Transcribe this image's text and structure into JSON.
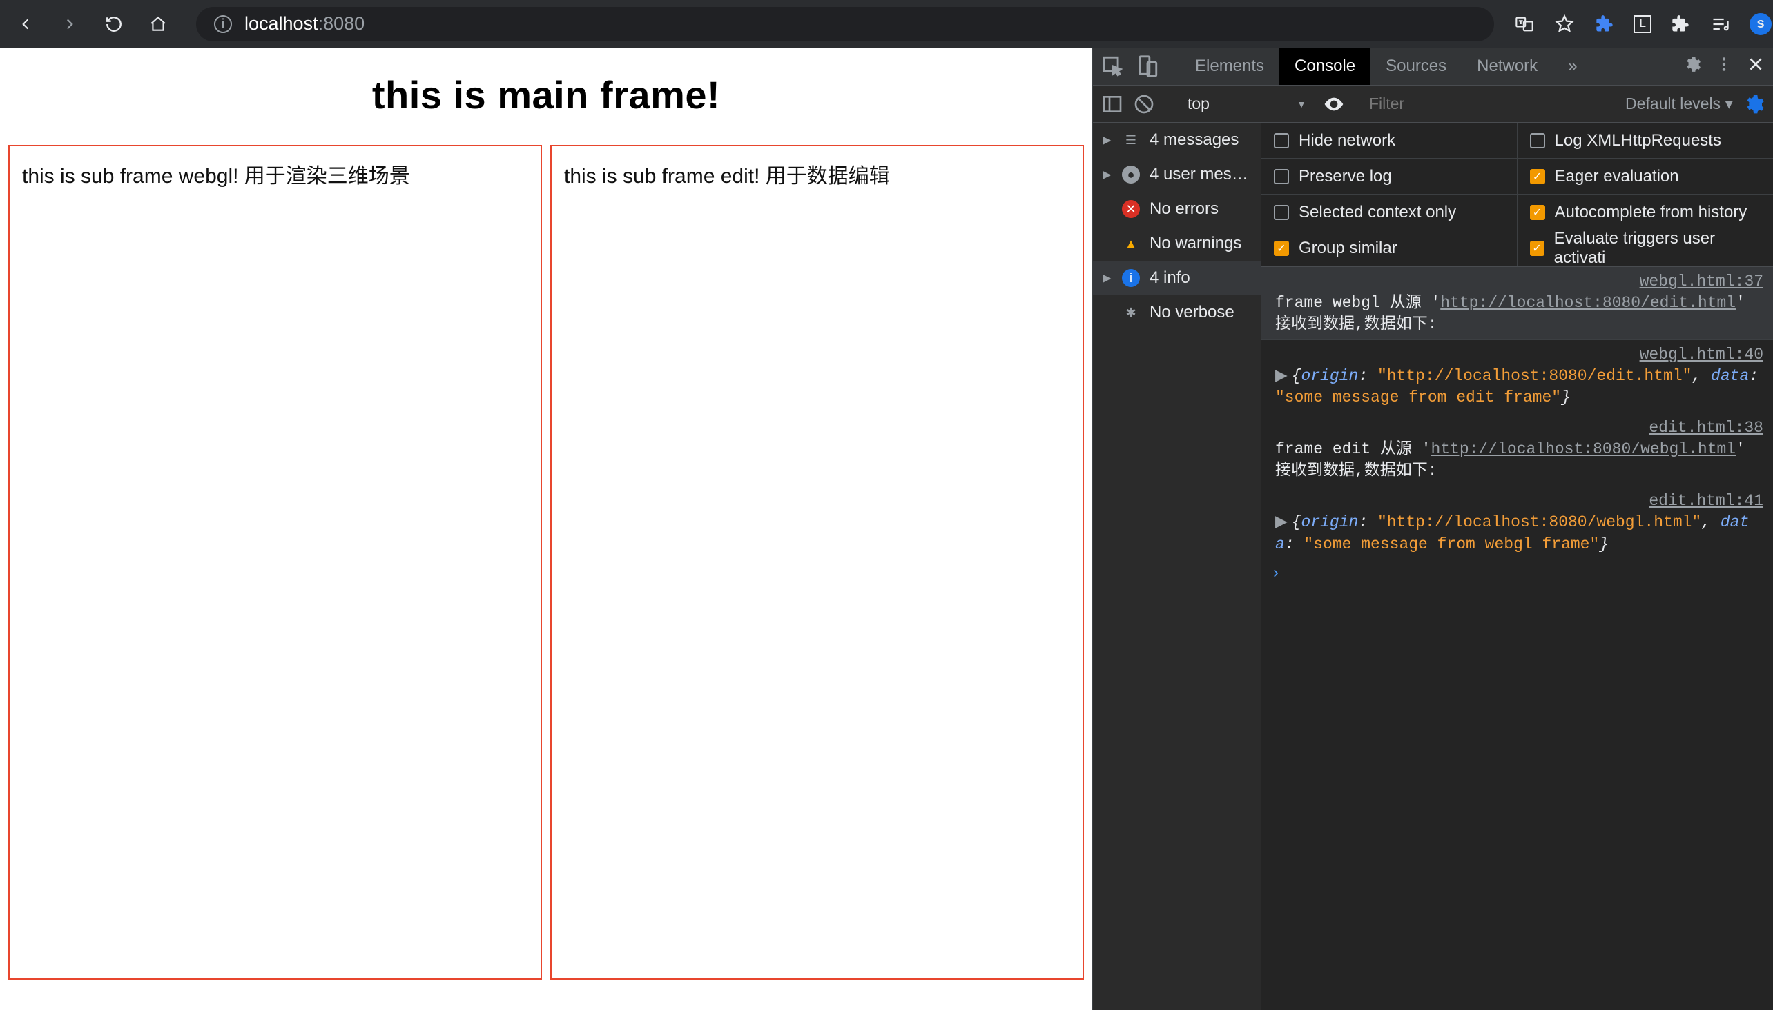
{
  "browser": {
    "url_host": "localhost",
    "url_port": ":8080",
    "avatar_letter": "s"
  },
  "page": {
    "title": "this is main frame!",
    "frame_webgl": "this is sub frame webgl! 用于渲染三维场景",
    "frame_edit": "this is sub frame edit! 用于数据编辑"
  },
  "devtools": {
    "tabs": {
      "elements": "Elements",
      "console": "Console",
      "sources": "Sources",
      "network": "Network",
      "more": "»"
    },
    "filterbar": {
      "context": "top",
      "filter_placeholder": "Filter",
      "levels": "Default levels ▾"
    },
    "sidebar": {
      "messages": "4 messages",
      "user": "4 user mes…",
      "errors": "No errors",
      "warnings": "No warnings",
      "info": "4 info",
      "verbose": "No verbose"
    },
    "settings": {
      "hide_network": "Hide network",
      "log_xhr": "Log XMLHttpRequests",
      "preserve_log": "Preserve log",
      "eager_eval": "Eager evaluation",
      "selected_ctx": "Selected context only",
      "autocomplete": "Autocomplete from history",
      "group_similar": "Group similar",
      "evaluate_triggers": "Evaluate triggers user activati"
    },
    "log": [
      {
        "source": "webgl.html:37",
        "text_pre": "frame webgl 从源 '",
        "text_link": "http://localhost:8080/edit.html",
        "text_post": "' 接收到数据,数据如下:"
      },
      {
        "source": "webgl.html:40",
        "obj_origin": "\"http://localhost:8080/edit.html\"",
        "obj_data": "\"some message from edit frame\""
      },
      {
        "source": "edit.html:38",
        "text_pre": "frame edit 从源 '",
        "text_link": "http://localhost:8080/webgl.html",
        "text_post": "' 接收到数据,数据如下:"
      },
      {
        "source": "edit.html:41",
        "obj_origin": "\"http://localhost:8080/webgl.html\"",
        "obj_data": "\"some message from webgl frame\""
      }
    ],
    "prompt": "›"
  }
}
